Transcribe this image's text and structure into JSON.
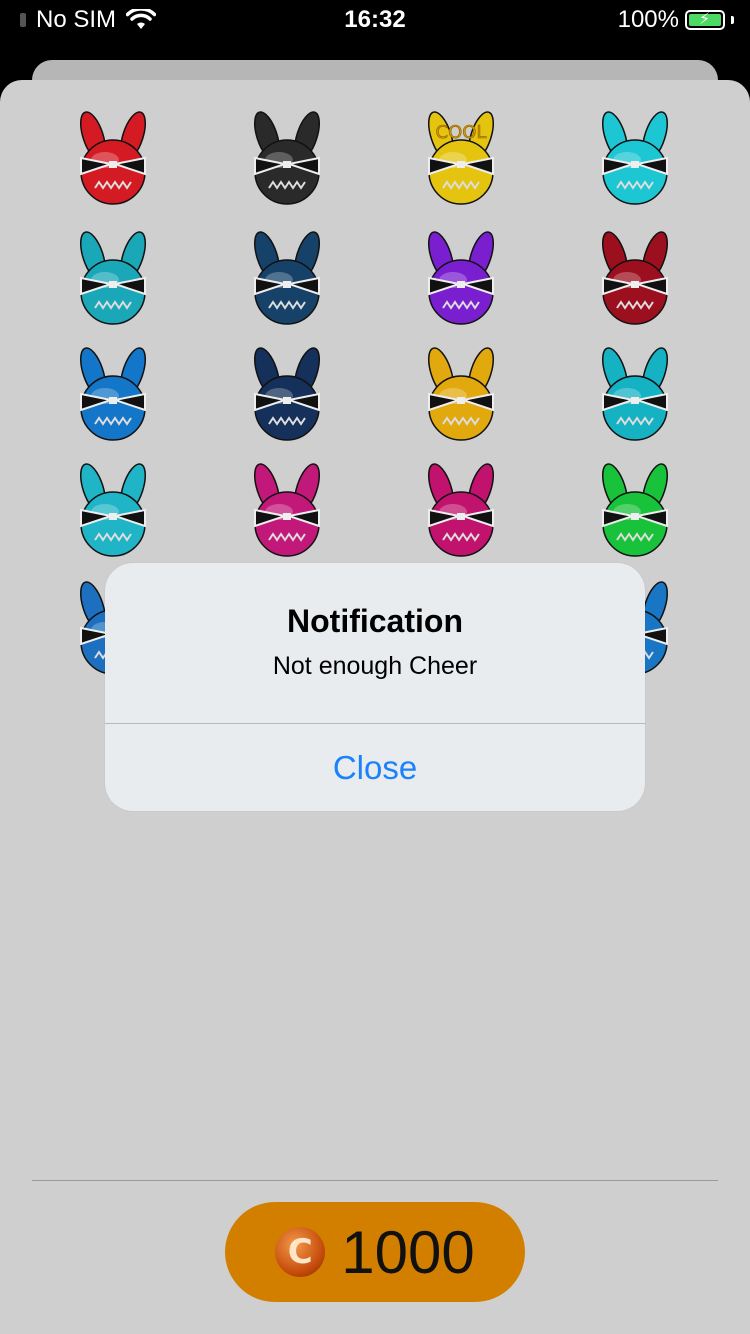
{
  "status_bar": {
    "carrier": "No SIM",
    "time": "16:32",
    "battery": "100%",
    "battery_level": 1.0
  },
  "stickers": [
    {
      "name": "red-bunny",
      "color": "#d41b23"
    },
    {
      "name": "black-x-bunny",
      "color": "#2a2a2a"
    },
    {
      "name": "cool-yellow-bunny",
      "color": "#e5c410",
      "label": "COOL"
    },
    {
      "name": "cyan-bunny",
      "color": "#1cc6d3"
    },
    {
      "name": "teal-bunny",
      "color": "#1aa8b8"
    },
    {
      "name": "navy-bunny",
      "color": "#16426a"
    },
    {
      "name": "purple-devil-bunny",
      "color": "#7a1fd0"
    },
    {
      "name": "red-halo-bunny",
      "color": "#9b0f1e"
    },
    {
      "name": "blue-bunny",
      "color": "#1476c8"
    },
    {
      "name": "dark-navy-bunny",
      "color": "#15305a"
    },
    {
      "name": "gold-halo-bunny",
      "color": "#e2a90e"
    },
    {
      "name": "teal-knives-bunny",
      "color": "#15b2c4"
    },
    {
      "name": "shark-bunny",
      "color": "#1fb4c6"
    },
    {
      "name": "magenta-bunny",
      "color": "#c2187a"
    },
    {
      "name": "pink-hearts-bunny",
      "color": "#c1126e"
    },
    {
      "name": "green-money-bunny",
      "color": "#18c23a"
    },
    {
      "name": "gray-fist-bunny",
      "color": "#1d6fbf"
    },
    {
      "name": "blue-partial-bunny",
      "color": "#1976c4"
    }
  ],
  "alert": {
    "title": "Notification",
    "message": "Not enough Cheer",
    "button": "Close"
  },
  "balance": {
    "amount": "1000",
    "coin_symbol": "C"
  },
  "colors": {
    "sheet_bg": "#cfcfcf",
    "pill_bg": "#d27f00",
    "alert_button": "#1a82fb"
  }
}
